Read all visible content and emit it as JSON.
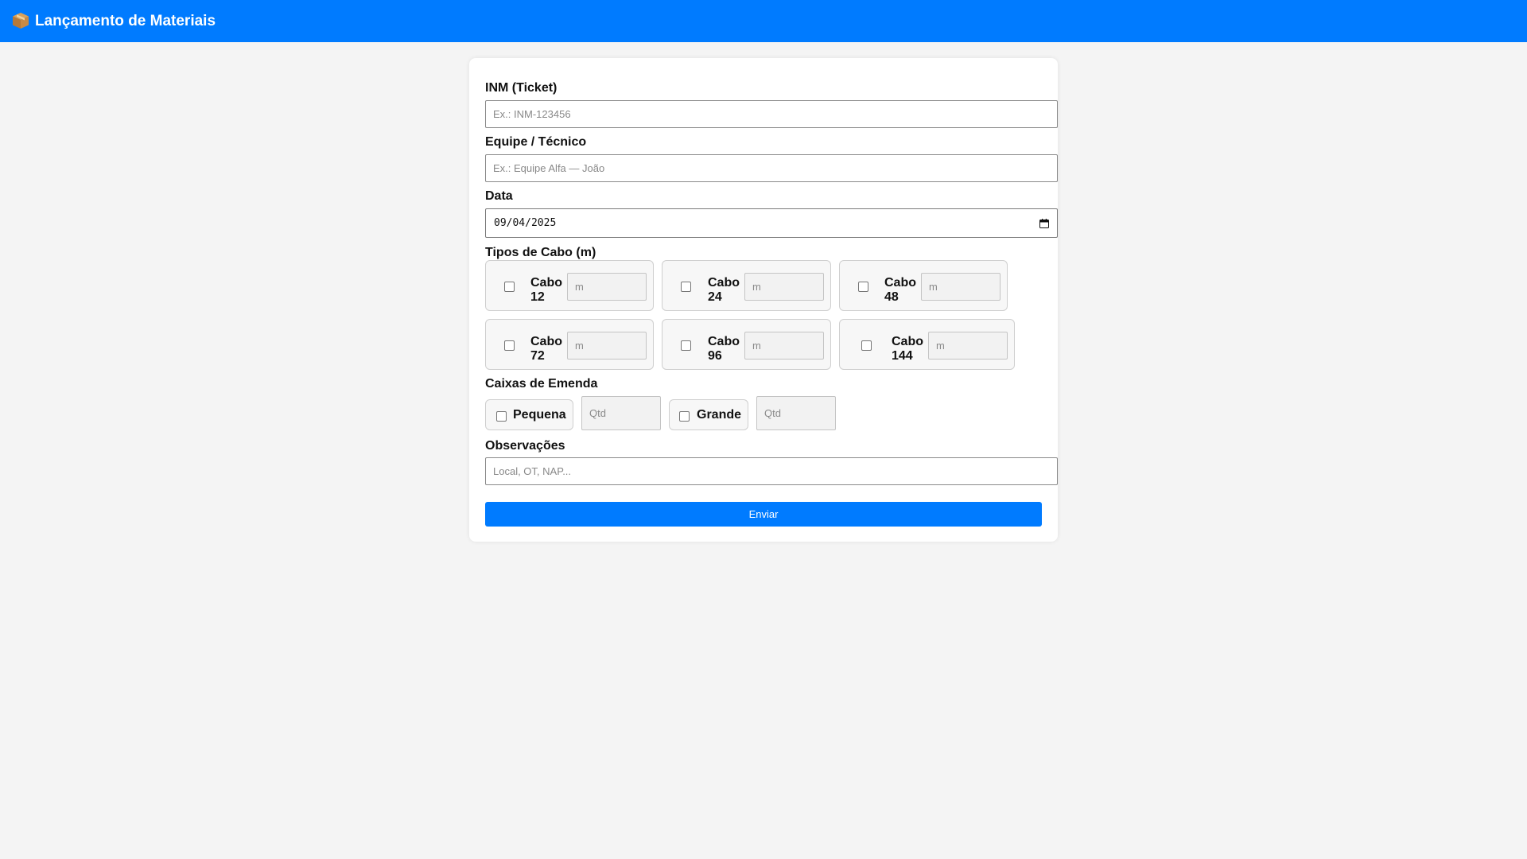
{
  "header": {
    "icon": "package-icon",
    "title": "Lançamento de Materiais",
    "bg_color": "#007bff"
  },
  "form": {
    "inm": {
      "label": "INM (Ticket)",
      "placeholder": "Ex.: INM-123456",
      "value": ""
    },
    "team": {
      "label": "Equipe / Técnico",
      "placeholder": "Ex.: Equipe Alfa — João",
      "value": ""
    },
    "date": {
      "label": "Data",
      "value": "09/04/2025"
    },
    "cables": {
      "label": "Tipos de Cabo (m)",
      "items": [
        {
          "line1": "Cabo",
          "line2": "12",
          "placeholder": "m",
          "checked": false
        },
        {
          "line1": "Cabo",
          "line2": "24",
          "placeholder": "m",
          "checked": false
        },
        {
          "line1": "Cabo",
          "line2": "48",
          "placeholder": "m",
          "checked": false
        },
        {
          "line1": "Cabo",
          "line2": "72",
          "placeholder": "m",
          "checked": false
        },
        {
          "line1": "Cabo",
          "line2": "96",
          "placeholder": "m",
          "checked": false
        },
        {
          "line1": "Cabo",
          "line2": "144",
          "placeholder": "m",
          "checked": false
        }
      ]
    },
    "boxes": {
      "label": "Caixas de Emenda",
      "items": [
        {
          "label": "Pequena",
          "placeholder": "Qtd",
          "checked": false
        },
        {
          "label": "Grande",
          "placeholder": "Qtd",
          "checked": false
        }
      ]
    },
    "notes": {
      "label": "Observações",
      "placeholder": "Local, OT, NAP...",
      "value": ""
    },
    "submit_label": "Enviar"
  }
}
